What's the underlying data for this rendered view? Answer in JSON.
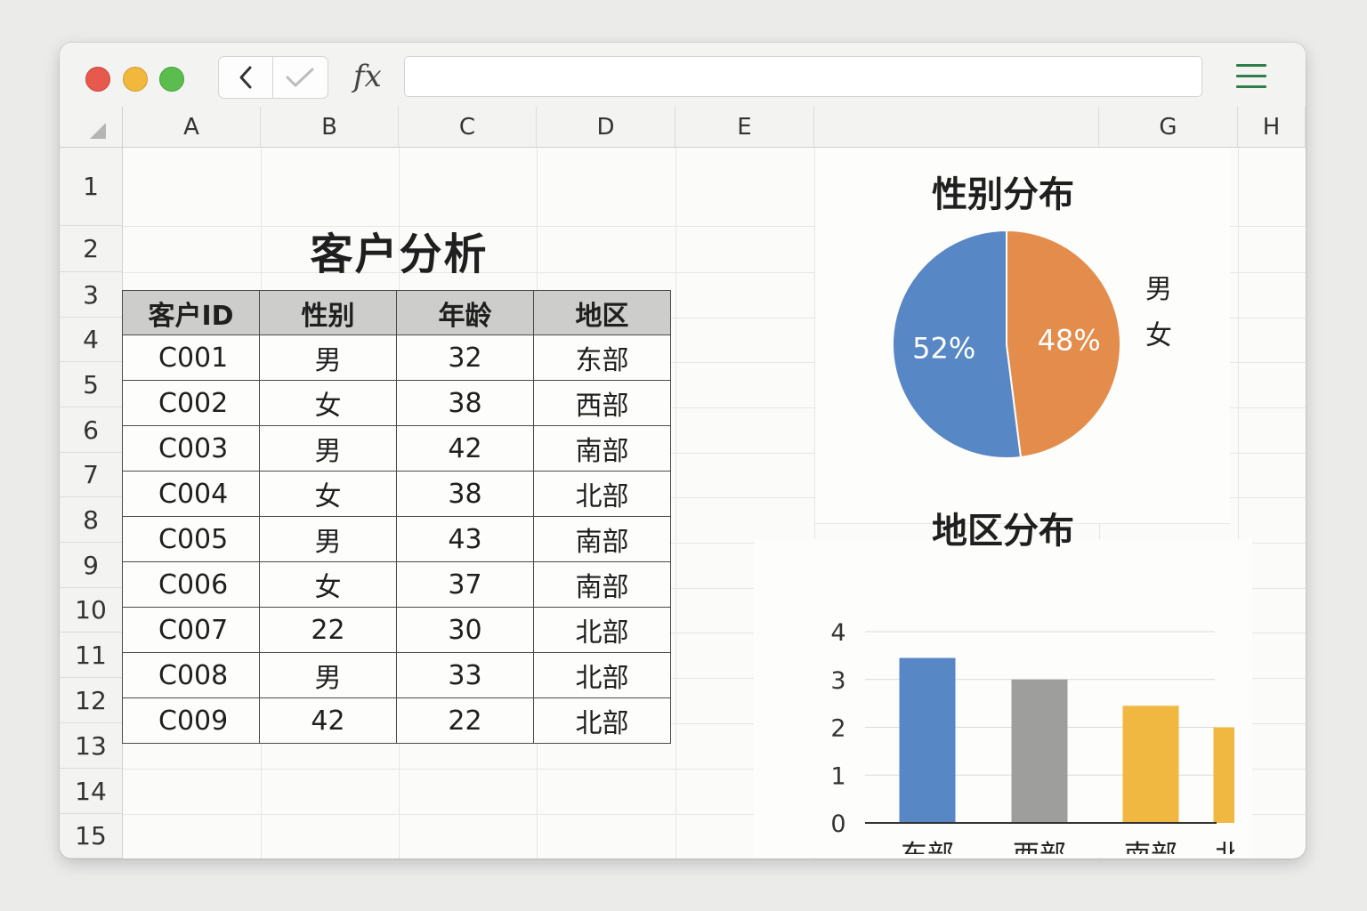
{
  "toolbar": {
    "fx_label": "fx",
    "formula_value": ""
  },
  "columns": [
    "A",
    "B",
    "C",
    "D",
    "E",
    "",
    "G",
    "H"
  ],
  "rows": [
    "1",
    "2",
    "3",
    "4",
    "5",
    "6",
    "7",
    "8",
    "9",
    "10",
    "11",
    "12",
    "13",
    "14",
    "15"
  ],
  "sheet": {
    "title": "客户分析",
    "headers": [
      "客户ID",
      "性别",
      "年龄",
      "地区"
    ],
    "rows": [
      [
        "C001",
        "男",
        "32",
        "东部"
      ],
      [
        "C002",
        "女",
        "38",
        "西部"
      ],
      [
        "C003",
        "男",
        "42",
        "南部"
      ],
      [
        "C004",
        "女",
        "38",
        "北部"
      ],
      [
        "C005",
        "男",
        "43",
        "南部"
      ],
      [
        "C006",
        "女",
        "37",
        "南部"
      ],
      [
        "C007",
        "22",
        "30",
        "北部"
      ],
      [
        "C008",
        "男",
        "33",
        "北部"
      ],
      [
        "C009",
        "42",
        "22",
        "北部"
      ]
    ]
  },
  "chart_data": [
    {
      "type": "pie",
      "title": "性别分布",
      "categories": [
        "男",
        "女"
      ],
      "values": [
        52,
        48
      ],
      "labels": [
        "52%",
        "48%"
      ],
      "colors": [
        "#5787c5",
        "#e38c4b"
      ],
      "legend": "right"
    },
    {
      "type": "bar",
      "title": "地区分布",
      "categories": [
        "东部",
        "西部",
        "南部",
        "北部"
      ],
      "values": [
        3.45,
        3.0,
        2.45,
        2.0
      ],
      "colors": [
        "#5787c5",
        "#9e9e9c",
        "#f0b841",
        "#f0b841"
      ],
      "ylim": [
        0,
        4
      ],
      "yticks": [
        "0",
        "1",
        "2",
        "3",
        "4"
      ],
      "grid": true
    }
  ]
}
